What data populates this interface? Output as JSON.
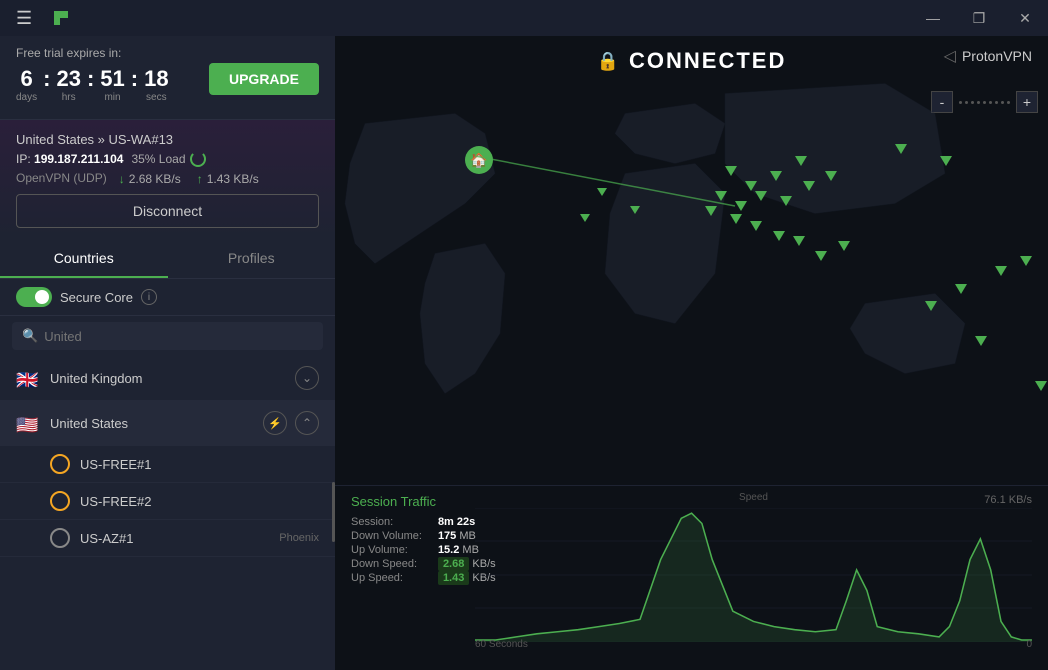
{
  "titlebar": {
    "minimize_label": "—",
    "maximize_label": "❐",
    "close_label": "✕"
  },
  "trial": {
    "label": "Free trial expires in:",
    "days": "6",
    "hrs": "23",
    "min": "51",
    "secs": "18",
    "days_label": "days",
    "hrs_label": "hrs",
    "min_label": "min",
    "secs_label": "secs",
    "upgrade_label": "UPGRADE"
  },
  "connection": {
    "location": "United States » US-WA#13",
    "ip_label": "IP:",
    "ip": "199.187.211.104",
    "load_label": "35% Load",
    "protocol": "OpenVPN (UDP)",
    "down_speed": "2.68 KB/s",
    "up_speed": "1.43 KB/s",
    "disconnect_label": "Disconnect"
  },
  "tabs": {
    "countries_label": "Countries",
    "profiles_label": "Profiles"
  },
  "secure_core": {
    "label": "Secure Core"
  },
  "search": {
    "placeholder": "United"
  },
  "countries": [
    {
      "name": "United Kingdom",
      "flag": "🇬🇧",
      "expanded": false
    },
    {
      "name": "United States",
      "flag": "🇺🇸",
      "expanded": true
    }
  ],
  "servers": [
    {
      "name": "US-FREE#1"
    },
    {
      "name": "US-FREE#2"
    },
    {
      "name": "US-AZ#1",
      "extra": "Phoenix"
    }
  ],
  "map": {
    "status_label": "CONNECTED",
    "brand": "ProtonVPN",
    "zoom_min": "-",
    "zoom_max": "+"
  },
  "chart": {
    "title": "Session Traffic",
    "session_label": "Session:",
    "session_value": "8m 22s",
    "down_vol_label": "Down Volume:",
    "down_vol_value": "175",
    "down_vol_unit": "MB",
    "up_vol_label": "Up Volume:",
    "up_vol_value": "15.2",
    "up_vol_unit": "MB",
    "down_speed_label": "Down Speed:",
    "down_speed_value": "2.68",
    "down_speed_unit": "KB/s",
    "up_speed_label": "Up Speed:",
    "up_speed_value": "1.43",
    "up_speed_unit": "KB/s",
    "speed_label": "Speed",
    "top_value": "76.1  KB/s",
    "bottom_left": "60 Seconds",
    "bottom_right": "0",
    "accent_color": "#4caf50"
  },
  "colors": {
    "accent": "#4caf50",
    "background": "#0d1117",
    "panel": "#1e2332",
    "border": "#2a2f40"
  }
}
